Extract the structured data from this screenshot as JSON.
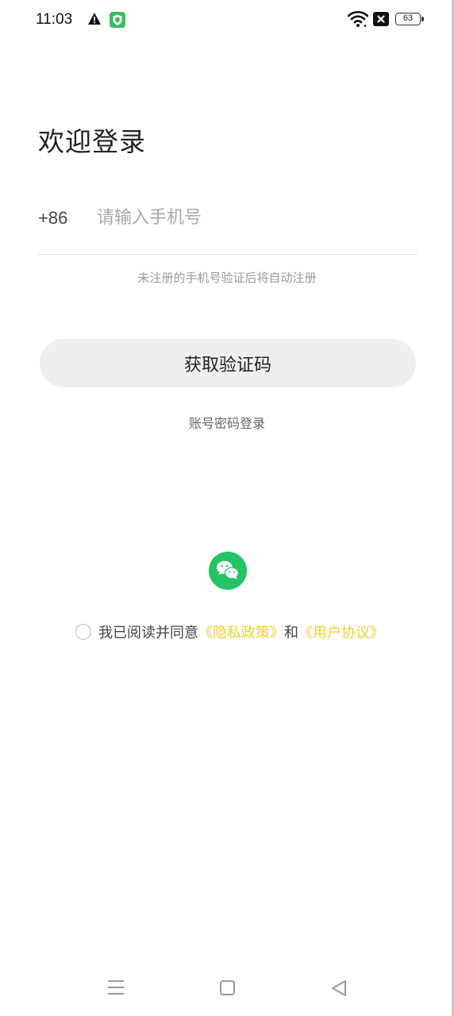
{
  "status_bar": {
    "time": "11:03",
    "battery_level": "63",
    "icons": [
      "warning-icon",
      "shield-icon",
      "wifi-icon",
      "no-sim-icon",
      "battery-icon"
    ]
  },
  "login": {
    "title": "欢迎登录",
    "country_code": "+86",
    "phone_placeholder": "请输入手机号",
    "phone_value": "",
    "hint": "未注册的手机号验证后将自动注册",
    "verify_button": "获取验证码",
    "password_login": "账号密码登录"
  },
  "third_party": {
    "wechat_icon": "wechat-icon",
    "wechat_color": "#22c463"
  },
  "agreement": {
    "checked": false,
    "prefix": "我已阅读并同意",
    "privacy_link": "《隐私政策》",
    "and": "和",
    "user_link": "《用户协议》",
    "link_color": "#f1cf2b"
  },
  "nav_bar": {
    "icons": [
      "menu-icon",
      "home-icon",
      "back-icon"
    ]
  },
  "colors": {
    "button_bg": "#efefef",
    "hint_gray": "#9a9a9a"
  }
}
